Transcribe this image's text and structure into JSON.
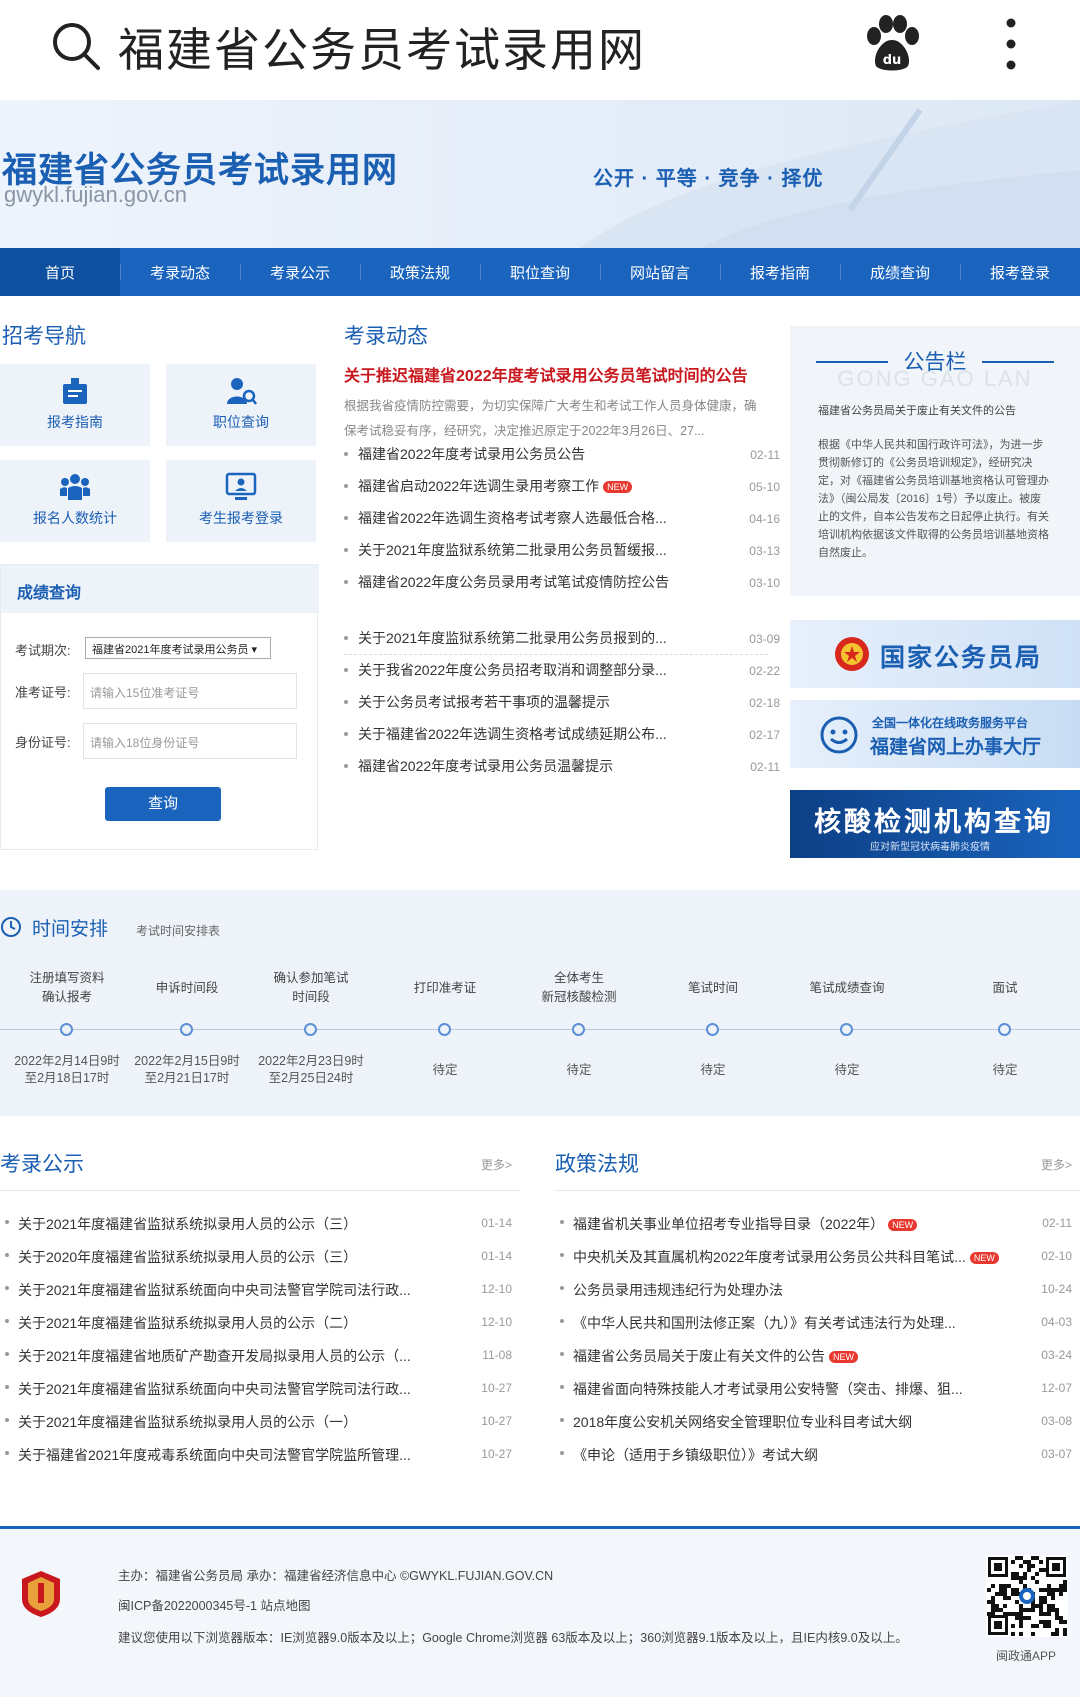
{
  "browser": {
    "title": "福建省公务员考试录用网"
  },
  "header": {
    "site_name": "福建省公务员考试录用网",
    "domain": "gwykl.fujian.gov.cn",
    "slogan": "公开 · 平等 · 竞争 · 择优"
  },
  "nav": [
    "首页",
    "考录动态",
    "考录公示",
    "政策法规",
    "职位查询",
    "网站留言",
    "报考指南",
    "成绩查询",
    "报考登录"
  ],
  "guide": {
    "title": "招考导航",
    "cards": [
      "报考指南",
      "职位查询",
      "报名人数统计",
      "考生报考登录"
    ]
  },
  "score": {
    "title": "成绩查询",
    "period_label": "考试期次:",
    "period_value": "福建省2021年度考试录用公务员",
    "ticket_label": "准考证号:",
    "ticket_placeholder": "请输入15位准考证号",
    "id_label": "身份证号:",
    "id_placeholder": "请输入18位身份证号",
    "submit": "查询"
  },
  "news": {
    "title": "考录动态",
    "headline": "关于推迟福建省2022年度考试录用公务员笔试时间的公告",
    "summary": "根据我省疫情防控需要，为切实保障广大考生和考试工作人员身体健康，确保考试稳妥有序，经研究，决定推迟原定于2022年3月26日、27...",
    "items": [
      {
        "title": "福建省2022年度考试录用公务员公告",
        "date": "02-11",
        "new": ""
      },
      {
        "title": "福建省启动2022年选调生录用考察工作",
        "date": "05-10",
        "new": "NEW"
      },
      {
        "title": "福建省2022年选调生资格考试考察人选最低合格...",
        "date": "04-16",
        "new": ""
      },
      {
        "title": "关于2021年度监狱系统第二批录用公务员暂缓报...",
        "date": "03-13",
        "new": ""
      },
      {
        "title": "福建省2022年度公务员录用考试笔试疫情防控公告",
        "date": "03-10",
        "new": ""
      },
      {
        "title": "关于2021年度监狱系统第二批录用公务员报到的...",
        "date": "03-09",
        "new": ""
      },
      {
        "title": "关于我省2022年度公务员招考取消和调整部分录...",
        "date": "02-22",
        "new": ""
      },
      {
        "title": "关于公务员考试报考若干事项的温馨提示",
        "date": "02-18",
        "new": ""
      },
      {
        "title": "关于福建省2022年选调生资格考试成绩延期公布...",
        "date": "02-17",
        "new": ""
      },
      {
        "title": "福建省2022年度考试录用公务员温馨提示",
        "date": "02-11",
        "new": ""
      }
    ]
  },
  "notice": {
    "title": "公告栏",
    "title_bg": "GONG GAO LAN",
    "head": "福建省公务员局关于废止有关文件的公告",
    "body": "根据《中华人民共和国行政许可法》，为进一步贯彻新修订的《公务员培训规定》，经研究决定，对《福建省公务员培训基地资格认可管理办法》（闽公局发〔2016〕1号）予以废止。被废止的文件，自本公告发布之日起停止执行。有关培训机构依据该文件取得的公务员培训基地资格自然废止。"
  },
  "banners": {
    "b1": "国家公务员局",
    "b2_top": "全国一体化在线政务服务平台",
    "b2_main": "福建省网上办事大厅",
    "b3_main": "核酸检测机构查询",
    "b3_sub": "应对新型冠状病毒肺炎疫情"
  },
  "timeline": {
    "title": "时间安排",
    "subtitle": "考试时间安排表",
    "steps": [
      {
        "title": "注册填写资料\n确认报考",
        "time": "2022年2月14日9时\n至2月18日17时"
      },
      {
        "title": "申诉时间段",
        "time": "2022年2月15日9时\n至2月21日17时"
      },
      {
        "title": "确认参加笔试\n时间段",
        "time": "2022年2月23日9时\n至2月25日24时"
      },
      {
        "title": "打印准考证",
        "time": "待定"
      },
      {
        "title": "全体考生\n新冠核酸检测",
        "time": "待定"
      },
      {
        "title": "笔试时间",
        "time": "待定"
      },
      {
        "title": "笔试成绩查询",
        "time": "待定"
      },
      {
        "title": "面试",
        "time": "待定"
      }
    ]
  },
  "publicity": {
    "title": "考录公示",
    "more": "更多>",
    "items": [
      {
        "title": "关于2021年度福建省监狱系统拟录用人员的公示（三）",
        "date": "01-14"
      },
      {
        "title": "关于2020年度福建省监狱系统拟录用人员的公示（三）",
        "date": "01-14"
      },
      {
        "title": "关于2021年度福建省监狱系统面向中央司法警官学院司法行政...",
        "date": "12-10"
      },
      {
        "title": "关于2021年度福建省监狱系统拟录用人员的公示（二）",
        "date": "12-10"
      },
      {
        "title": "关于2021年度福建省地质矿产勘查开发局拟录用人员的公示（...",
        "date": "11-08"
      },
      {
        "title": "关于2021年度福建省监狱系统面向中央司法警官学院司法行政...",
        "date": "10-27"
      },
      {
        "title": "关于2021年度福建省监狱系统拟录用人员的公示（一）",
        "date": "10-27"
      },
      {
        "title": "关于福建省2021年度戒毒系统面向中央司法警官学院监所管理...",
        "date": "10-27"
      }
    ]
  },
  "policy": {
    "title": "政策法规",
    "more": "更多>",
    "items": [
      {
        "title": "福建省机关事业单位招考专业指导目录（2022年）",
        "date": "02-11",
        "new": "NEW"
      },
      {
        "title": "中央机关及其直属机构2022年度考试录用公务员公共科目笔试...",
        "date": "02-10",
        "new": "NEW"
      },
      {
        "title": "公务员录用违规违纪行为处理办法",
        "date": "10-24",
        "new": ""
      },
      {
        "title": "《中华人民共和国刑法修正案（九）》有关考试违法行为处理...",
        "date": "04-03",
        "new": ""
      },
      {
        "title": "福建省公务员局关于废止有关文件的公告",
        "date": "03-24",
        "new": "NEW"
      },
      {
        "title": "福建省面向特殊技能人才考试录用公安特警（突击、排爆、狙...",
        "date": "12-07",
        "new": ""
      },
      {
        "title": "2018年度公安机关网络安全管理职位专业科目考试大纲",
        "date": "03-08",
        "new": ""
      },
      {
        "title": "《申论（适用于乡镇级职位）》考试大纲",
        "date": "03-07",
        "new": ""
      }
    ]
  },
  "footer": {
    "line1": "主办：福建省公务员局   承办：福建省经济信息中心   ©GWYKL.FUJIAN.GOV.CN",
    "line2": "闽ICP备2022000345号-1   站点地图",
    "line3": "建议您使用以下浏览器版本：IE浏览器9.0版本及以上；Google Chrome浏览器 63版本及以上；360浏览器9.1版本及以上，且IE内核9.0及以上。",
    "qr_label": "闽政通APP"
  },
  "colors": {
    "brand": "#1a64be",
    "headline": "#c8171d",
    "badge": "#e8382f"
  },
  "icons": [
    "search-icon",
    "baidu-paw-icon",
    "more-vertical-icon",
    "clock-icon",
    "qr-code-icon"
  ]
}
